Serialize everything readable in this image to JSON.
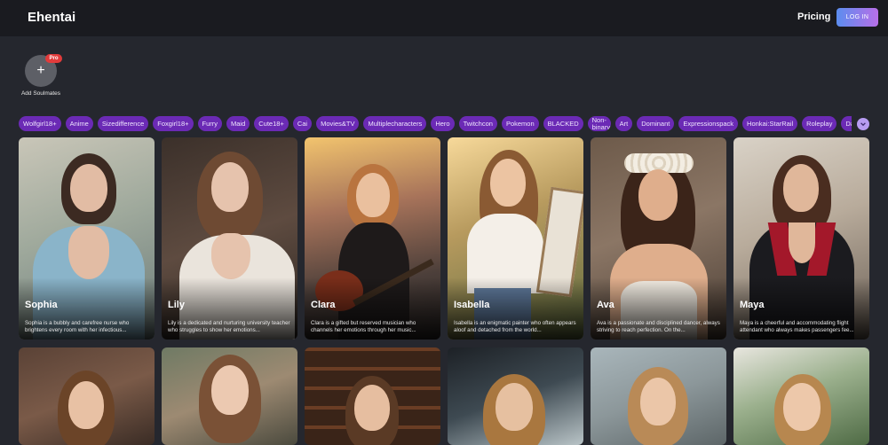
{
  "header": {
    "logo": "Ehentai",
    "pricing_label": "Pricing",
    "login_label": "LOG IN"
  },
  "add_soulmates": {
    "badge": "Pro",
    "label": "Add Soulmates"
  },
  "tags": [
    "Wolfgirl18+",
    "Anime",
    "Sizedifference",
    "Foxgirl18+",
    "Furry",
    "Maid",
    "Cute18+",
    "Cai",
    "Movies&TV",
    "Multiplecharacters",
    "Hero",
    "Twitchcon",
    "Pokemon",
    "BLACKED",
    "Non-binary",
    "Art",
    "Dominant",
    "Expressionspack",
    "Honkai:StarRail",
    "Roleplay",
    "Darkt"
  ],
  "cards": [
    {
      "name": "Sophia",
      "desc": "Sophia is a bubbly and carefree nurse who brightens every room with her infectious..."
    },
    {
      "name": "Lily",
      "desc": "Lily is a dedicated and nurturing university teacher who struggles to show her emotions..."
    },
    {
      "name": "Clara",
      "desc": "Clara is a gifted but reserved musician who channels her emotions through her music..."
    },
    {
      "name": "Isabella",
      "desc": "Isabella is an enigmatic painter who often appears aloof and detached from the world..."
    },
    {
      "name": "Ava",
      "desc": "Ava is a passionate and disciplined dancer, always striving to reach perfection. On the..."
    },
    {
      "name": "Maya",
      "desc": "Maya is a cheerful and accommodating flight attendant who always makes passengers fee..."
    }
  ],
  "icons": {
    "add": "plus-icon",
    "scroll": "chevron-down-icon"
  },
  "colors": {
    "accent_tag": "#6b2ab5",
    "pro_badge": "#e23b3b"
  }
}
